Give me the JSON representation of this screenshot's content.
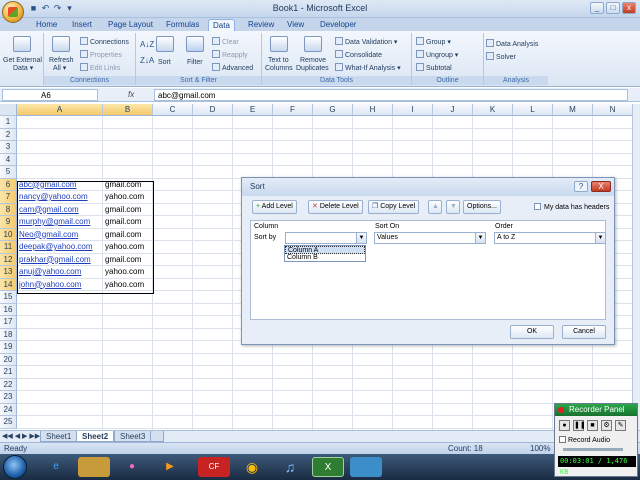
{
  "window": {
    "title": "Book1 - Microsoft Excel"
  },
  "ribbon": {
    "tabs": [
      "Home",
      "Insert",
      "Page Layout",
      "Formulas",
      "Data",
      "Review",
      "View",
      "Developer"
    ],
    "active_tab": "Data",
    "groups": {
      "get_external": {
        "label": "Get External\nData",
        "line1": "Get External",
        "line2": "Data ▾"
      },
      "connections": {
        "label": "Connections",
        "refresh1": "Refresh",
        "refresh2": "All ▾",
        "connections": "Connections",
        "properties": "Properties",
        "edit_links": "Edit Links"
      },
      "sort_filter": {
        "label": "Sort & Filter",
        "sort": "Sort",
        "filter": "Filter",
        "clear": "Clear",
        "reapply": "Reapply",
        "advanced": "Advanced"
      },
      "data_tools": {
        "label": "Data Tools",
        "text1": "Text to",
        "text2": "Columns",
        "remove1": "Remove",
        "remove2": "Duplicates",
        "validation": "Data Validation ▾",
        "consolidate": "Consolidate",
        "whatif": "What-If Analysis ▾"
      },
      "outline": {
        "label": "Outline",
        "group": "Group ▾",
        "ungroup": "Ungroup ▾",
        "subtotal": "Subtotal"
      },
      "analysis": {
        "label": "Analysis",
        "data_analysis": "Data Analysis",
        "solver": "Solver"
      }
    }
  },
  "formula_bar": {
    "name_box": "A6",
    "fx": "fx",
    "formula": "abc@gmail.com"
  },
  "grid": {
    "columns": [
      "A",
      "B",
      "C",
      "D",
      "E",
      "F",
      "G",
      "H",
      "I",
      "J",
      "K",
      "L",
      "M",
      "N"
    ],
    "rows": [
      "1",
      "2",
      "3",
      "4",
      "5",
      "6",
      "7",
      "8",
      "9",
      "10",
      "11",
      "12",
      "13",
      "14",
      "15",
      "16",
      "17",
      "18",
      "19",
      "20",
      "21",
      "22",
      "23",
      "24",
      "25"
    ],
    "data": [
      {
        "row": "6",
        "a": "abc@gmail.com",
        "b": "gmail.com"
      },
      {
        "row": "7",
        "a": "nancy@yahoo.com",
        "b": "yahoo.com"
      },
      {
        "row": "8",
        "a": "cam@gmail.com",
        "b": "gmail.com"
      },
      {
        "row": "9",
        "a": "murphy@gmail.com",
        "b": "gmail.com"
      },
      {
        "row": "10",
        "a": "Neo@gmail.com",
        "b": "gmail.com"
      },
      {
        "row": "11",
        "a": "deepak@yahoo.com",
        "b": "yahoo.com"
      },
      {
        "row": "12",
        "a": "prakhar@gmail.com",
        "b": "gmail.com"
      },
      {
        "row": "13",
        "a": "anuj@yahoo.com",
        "b": "yahoo.com"
      },
      {
        "row": "14",
        "a": "john@yahoo.com",
        "b": "yahoo.com"
      }
    ]
  },
  "sheets": {
    "tabs": [
      "Sheet1",
      "Sheet2",
      "Sheet3"
    ],
    "active": "Sheet2"
  },
  "status": {
    "left": "Ready",
    "count": "Count: 18",
    "zoom": "100%"
  },
  "sort_dialog": {
    "title": "Sort",
    "help": "?",
    "close": "X",
    "add_level": "Add Level",
    "delete_level": "Delete Level",
    "copy_level": "Copy Level",
    "up": "▲",
    "down": "▼",
    "options": "Options...",
    "headers_label": "My data has headers",
    "col_header": "Column",
    "sorton_header": "Sort On",
    "order_header": "Order",
    "sort_by": "Sort by",
    "sort_by_value": "",
    "sort_on_value": "Values",
    "order_value": "A to Z",
    "list_options": [
      "Column A",
      "Column B"
    ],
    "ok": "OK",
    "cancel": "Cancel"
  },
  "recorder": {
    "title": "Recorder Panel",
    "record_audio": "Record Audio",
    "time": "00:03:01 / 1,476 KB"
  },
  "colors": {
    "accent": "#15428b",
    "link": "#1f3fbf",
    "selection": "#f5c96a"
  }
}
